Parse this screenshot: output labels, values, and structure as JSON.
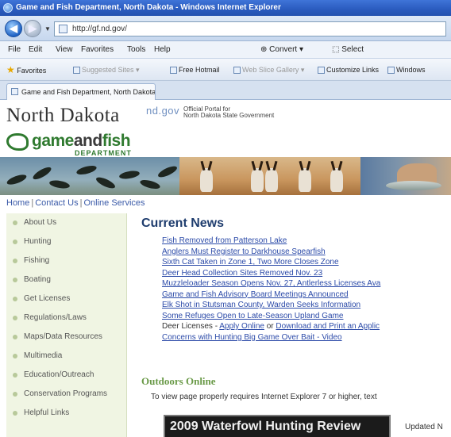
{
  "window": {
    "title": "Game and Fish Department, North Dakota - Windows Internet Explorer"
  },
  "address": {
    "url": "http://gf.nd.gov/"
  },
  "menu": {
    "items": [
      "File",
      "Edit",
      "View",
      "Favorites",
      "Tools",
      "Help"
    ],
    "convert_label": "Convert",
    "select_label": "Select"
  },
  "favorites_bar": {
    "favorites_label": "Favorites",
    "suggested_sites": "Suggested Sites",
    "free_hotmail": "Free Hotmail",
    "web_slice_gallery": "Web Slice Gallery",
    "customize_links": "Customize Links",
    "windows": "Windows"
  },
  "tab": {
    "label": "Game and Fish Department, North Dakota"
  },
  "header": {
    "state": "North Dakota",
    "ndgov": "nd.gov",
    "portal_line1": "Official Portal for",
    "portal_line2": "North Dakota State Government",
    "logo_game": "game",
    "logo_and": "and",
    "logo_fish": "fish",
    "logo_department": "DEPARTMENT"
  },
  "topnav": {
    "home": "Home",
    "contact": "Contact Us",
    "online": "Online Services",
    "sep": "|"
  },
  "sidebar": {
    "items": [
      {
        "label": "About Us"
      },
      {
        "label": "Hunting"
      },
      {
        "label": "Fishing"
      },
      {
        "label": "Boating"
      },
      {
        "label": "Get Licenses"
      },
      {
        "label": "Regulations/Laws"
      },
      {
        "label": "Maps/Data Resources"
      },
      {
        "label": "Multimedia"
      },
      {
        "label": "Education/Outreach"
      },
      {
        "label": "Conservation Programs"
      },
      {
        "label": "Helpful Links"
      }
    ]
  },
  "news": {
    "heading": "Current News",
    "items": [
      "Fish Removed from Patterson Lake",
      "Anglers Must Register to Darkhouse Spearfish",
      "Sixth Cat Taken in Zone 1, Two More Closes Zone",
      "Deer Head Collection Sites Removed Nov. 23",
      "Muzzleloader Season Opens Nov. 27, Antlerless Licenses Ava",
      "Game and Fish Advisory Board Meetings Announced",
      "Elk Shot in Stutsman County, Warden Seeks Information",
      "Some Refuges Open to Late-Season Upland Game"
    ],
    "deer_prefix": "Deer Licenses - ",
    "deer_link1": "Apply Online",
    "deer_or": " or ",
    "deer_link2": "Download and Print an Applic",
    "last_item": "Concerns with Hunting Big Game Over Bait - Video"
  },
  "outdoors": {
    "heading": "Outdoors Online",
    "note": "To view page properly requires Internet Explorer 7 or higher, text",
    "video_title": "2009 Waterfowl Hunting Review",
    "updated": "Updated N"
  },
  "colors": {
    "link": "#2b4aa8",
    "logo_green": "#2f7a2f",
    "heading_blue": "#1f3d6e",
    "sidebar_bg": "#f0f5e3"
  }
}
